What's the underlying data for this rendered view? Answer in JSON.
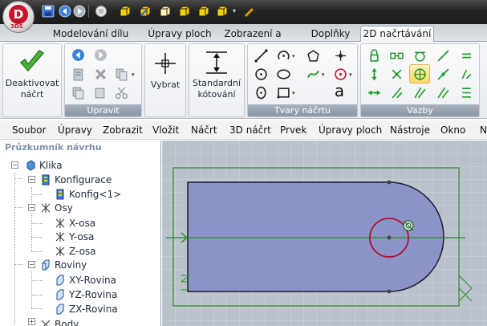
{
  "app": {
    "logo_text": "D",
    "logo_sub": "3DS"
  },
  "quick_access": [
    "save-icon",
    "back-icon",
    "forward-icon",
    "new-block-icon",
    "box-yellow-icon",
    "box-edit-icon",
    "box-outline-icon",
    "box-toggle-icon",
    "box-arrow-icon",
    "pencil-icon"
  ],
  "tabs": [
    {
      "label": "Modelování dílu",
      "active": false
    },
    {
      "label": "Úpravy ploch",
      "active": false
    },
    {
      "label": "Zobrazení a analýza",
      "active": false
    },
    {
      "label": "Doplňky",
      "active": false
    },
    {
      "label": "2D načrtávání",
      "active": true
    }
  ],
  "ribbon": {
    "deactivate_label": "Deaktivovat\nnáčrt",
    "edit_group": "Upravit",
    "select_label": "Vybrat",
    "dim_label": "Standardní\nkótování",
    "shapes_group": "Tvary náčrtu",
    "constraints_group": "Vazby",
    "text_tool": "a"
  },
  "menu": [
    "Soubor",
    "Úpravy",
    "Zobrazit",
    "Vložit",
    "Náčrt",
    "3D náčrt",
    "Prvek",
    "Úpravy ploch",
    "Nástroje",
    "Okno",
    "N"
  ],
  "explorer": {
    "title": "Průzkumník návrhu",
    "tree": [
      {
        "label": "Klika",
        "icon": "part-icon"
      },
      {
        "label": "Konfigurace",
        "icon": "configuration-icon"
      },
      {
        "label": "Konfig<1>",
        "icon": "configuration-icon"
      },
      {
        "label": "Osy",
        "icon": "axes-icon"
      },
      {
        "label": "X-osa",
        "icon": "axis-icon"
      },
      {
        "label": "Y-osa",
        "icon": "axis-icon"
      },
      {
        "label": "Z-osa",
        "icon": "axis-icon"
      },
      {
        "label": "Roviny",
        "icon": "planes-icon"
      },
      {
        "label": "XY-Rovina",
        "icon": "plane-icon"
      },
      {
        "label": "YZ-Rovina",
        "icon": "plane-icon"
      },
      {
        "label": "ZX-Rovina",
        "icon": "plane-icon"
      },
      {
        "label": "Body",
        "icon": "points-icon"
      }
    ]
  },
  "colors": {
    "accent": "#2a7a2a",
    "sketch_fill": "#8b93c8",
    "circle": "#b0102a",
    "canvas": "#b9c1ca"
  }
}
